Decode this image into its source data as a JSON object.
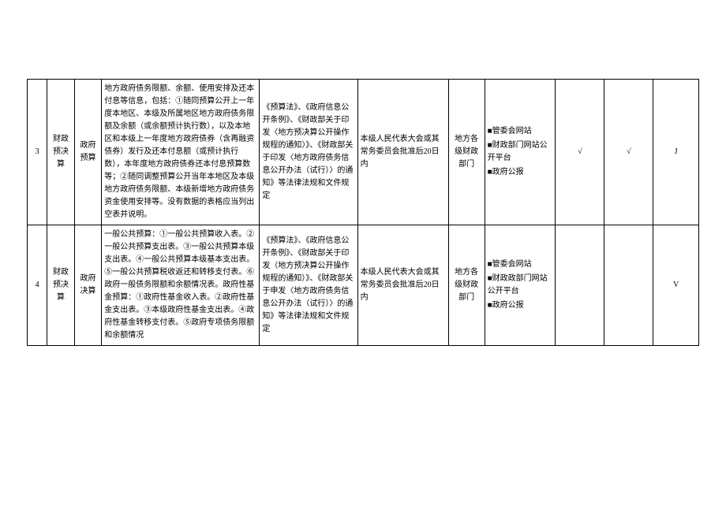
{
  "rows": [
    {
      "num": "3",
      "cat1": "财政预决算",
      "cat2": "政府预算",
      "content": "地方政府债务限额、余额、使用安排及还本付息等信息，包括：①随同预算公开上一年度本地区、本级及所属地区地方政府债务限额及余额（或余额预计执行数），以及本地区和本级上一年度地方政府债券（含再融资债券）发行及还本付息额（或预计执行数），本年度地方政府债券还本付息预算数等；②随同调整预算公开当年本地区及本级地方政府债务限额、本级新增地方政府债务资金使用安排等。没有数据的表格应当列出空表并说明。",
      "basis": "《预算法》、《政府信息公开条例》、《财政部关于印发〈地方预决算公开操作规程的通知〉》、《财政部关于印发〈地方政府债务信息公开办法（试行）〉的通知》等法律法规和文件规定",
      "time": "本级人民代表大会或其常务委员会批准后20日内",
      "subj": "地方各级财政部门",
      "channels": [
        "■管委会网站",
        "■财政部门网站公开平台",
        "■政府公报"
      ],
      "ck1": "√",
      "ck2": "√",
      "ck3": "J"
    },
    {
      "num": "4",
      "cat1": "财政预决算",
      "cat2": "政府决算",
      "content": "一般公共预算：①一般公共预算收入表。②一般公共预算支出表。③一般公共预算本级支出表。④一般公共预算本级基本支出表。⑤一般公共预算税收返还和转移支付表。⑥政府一般债务限额和余额情况表。政府性基金预算：①政府性基金收入表。②政府性基金支出表。③本级政府性基金支出表。④政府性基金转移支付表。⑤政府专项债务限额和余额情况",
      "basis": "《预算法》、《政府信息公开条例》、《财政部关于印发（地方预决算公开操作规程的通知）》、《财政部关于申发〈地方政府债务信息公开办法（试行）〉的通知》等法律法规和文件规定",
      "time": "本级人民代表大会或其常务委员会批准后20日内",
      "subj": "地方各级财政部门",
      "channels": [
        "■管委会网站",
        "■财政政部门网站公开平台",
        "■政府公报"
      ],
      "ck1": "",
      "ck2": "",
      "ck3": "V"
    }
  ]
}
